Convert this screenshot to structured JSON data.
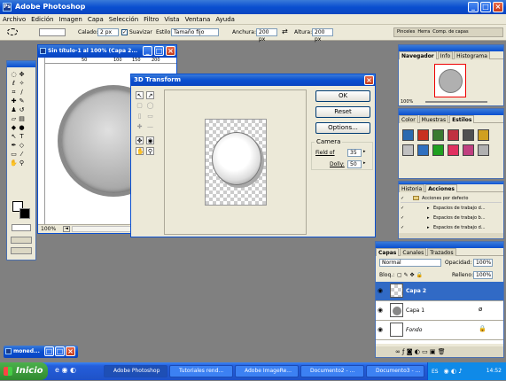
{
  "app": {
    "title": "Adobe Photoshop"
  },
  "menu": [
    "Archivo",
    "Edición",
    "Imagen",
    "Capa",
    "Selección",
    "Filtro",
    "Vista",
    "Ventana",
    "Ayuda"
  ],
  "options": {
    "calado_label": "Calado:",
    "calado_value": "2 px",
    "suavizar_label": "Suavizar",
    "estilo_label": "Estilo:",
    "estilo_value": "Tamaño fijo",
    "anchura_label": "Anchura:",
    "anchura_value": "200 px",
    "altura_label": "Altura:",
    "altura_value": "200 px",
    "wells": [
      "Pinceles",
      "Herra",
      "Comp. de capas"
    ]
  },
  "document": {
    "title": "Sin título-1 al 100% (Capa 2...",
    "zoom": "100%",
    "ruler": [
      "50",
      "100",
      "150",
      "200"
    ]
  },
  "dialog": {
    "title": "3D Transform",
    "ok": "OK",
    "reset": "Reset",
    "options": "Options...",
    "camera_label": "Camera",
    "fov_label": "Field of",
    "fov_value": "35",
    "dolly_label": "Dolly:",
    "dolly_value": "50"
  },
  "navigator": {
    "tabs": [
      "Navegador",
      "Info",
      "Histograma"
    ],
    "zoom": "100%"
  },
  "styles": {
    "tabs": [
      "Color",
      "Muestras",
      "Estilos"
    ],
    "swatches": [
      "#2a6ab0",
      "#c83020",
      "#3a7a30",
      "#c03040",
      "#505050",
      "#d0a020",
      "#c0c0c0",
      "#3070c0",
      "#20a020",
      "#e03060",
      "#c04080",
      "#b0b0b0"
    ]
  },
  "actions": {
    "tabs": [
      "Historia",
      "Acciones"
    ],
    "items": [
      "Acciones por defecto",
      "Espacios de trabajo d...",
      "Espacios de trabajo b...",
      "Espacios de trabajo d..."
    ]
  },
  "layers": {
    "tabs": [
      "Capas",
      "Canales",
      "Trazados"
    ],
    "mode": "Normal",
    "opacity_label": "Opacidad:",
    "opacity_value": "100%",
    "lock_label": "Bloq.:",
    "fill_label": "Relleno:",
    "fill_value": "100%",
    "items": [
      "Capa 2",
      "Capa 1",
      "Fondo"
    ]
  },
  "minimized": {
    "title": "moned..."
  },
  "taskbar": {
    "start": "Inicio",
    "items": [
      "Adobe Photoshop",
      "Tutoriales rend...",
      "Adobe ImageRe...",
      "Documento2 - ...",
      "Documento3 - ..."
    ],
    "lang": "ES",
    "clock": "14:52"
  },
  "colors": {
    "xp_blue": "#0a4fd0",
    "taskbar": "#245edb",
    "start": "#3c9a3c",
    "selected_layer": "#316ac5"
  }
}
